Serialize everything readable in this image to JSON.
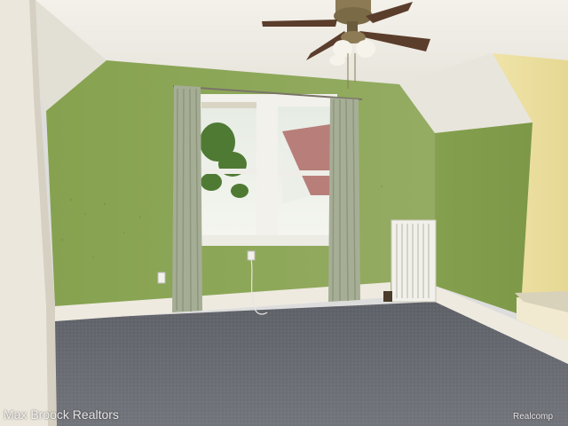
{
  "photo": {
    "subject": "empty attic bedroom",
    "colors": {
      "wall_green": "#8fa85a",
      "ceiling": "#ece9e0",
      "carpet": "#6b6d74",
      "trim": "#eeeae0",
      "curtain": "#a6ae96"
    }
  },
  "watermarks": {
    "left": "Max Broock Realtors",
    "right": "Realcomp"
  }
}
